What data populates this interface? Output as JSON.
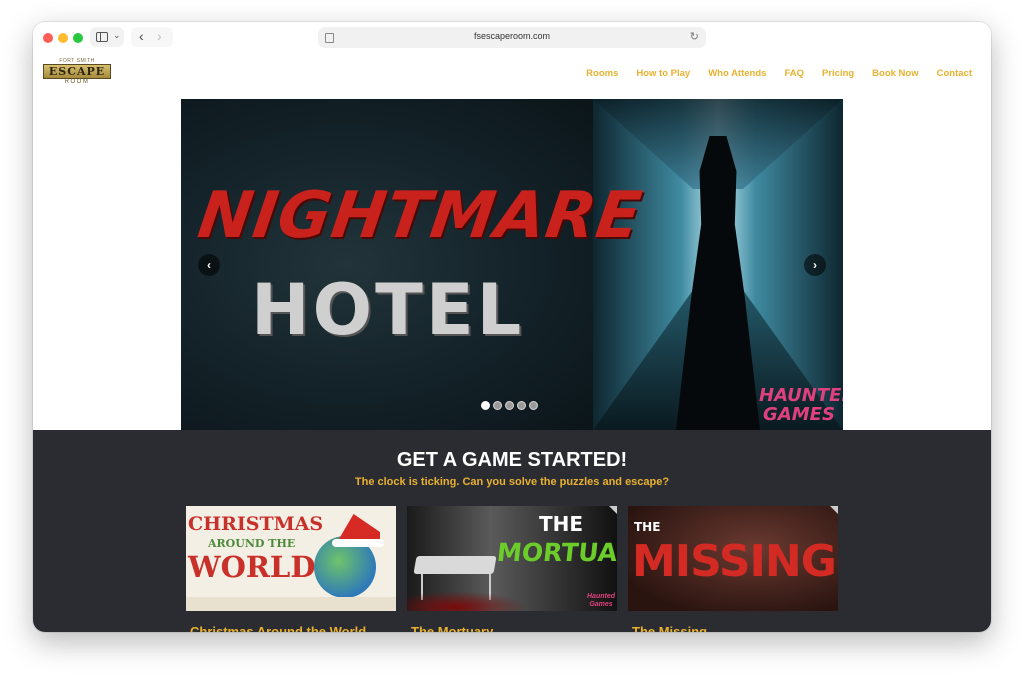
{
  "browser": {
    "url": "fsescaperoom.com"
  },
  "logo": {
    "top_text": "FORT SMITH",
    "main_text": "ESCAPE",
    "bottom_text": "ROOM"
  },
  "nav": {
    "items": [
      "Rooms",
      "How to Play",
      "Who Attends",
      "FAQ",
      "Pricing",
      "Book Now",
      "Contact"
    ]
  },
  "hero": {
    "title_line1": "NIGHTMARE",
    "title_line2": "HOTEL",
    "brand_line1": "HAUNTED",
    "brand_line2": "GAMES",
    "slide_count": 5,
    "active_slide": 1
  },
  "games": {
    "heading": "GET A GAME STARTED!",
    "tagline": "The clock is ticking. Can you solve the puzzles and escape?",
    "cards": [
      {
        "name": "Christmas Around the World",
        "art_line1": "CHRISTMAS",
        "art_line2": "AROUND THE",
        "art_line3": "WORLD"
      },
      {
        "name": "The Mortuary",
        "art_line1": "THE",
        "art_line2": "MORTUARY",
        "art_badge1": "Haunted",
        "art_badge2": "Games"
      },
      {
        "name": "The Missing",
        "art_line1": "THE",
        "art_line2": "MISSING"
      }
    ]
  },
  "colors": {
    "accent": "#e8b230",
    "dark_section": "#2b2c31",
    "nightmare_red": "#c9221c",
    "mortuary_green": "#6ccc2a"
  }
}
